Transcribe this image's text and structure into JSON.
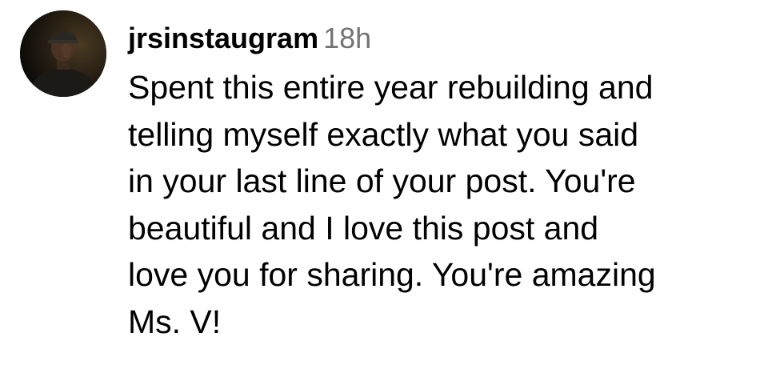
{
  "comment": {
    "avatar_icon": "user-avatar-photo",
    "username": "jrsinstaugram",
    "timestamp": "18h",
    "text_lines": [
      "Spent this entire year rebuilding and",
      "telling myself exactly what you said",
      "in your last line of your post. You're",
      "beautiful and I love this post and",
      "love you for sharing. You're amazing",
      "Ms. V!"
    ]
  },
  "colors": {
    "text": "#000000",
    "timestamp": "#737373",
    "background": "#ffffff"
  }
}
